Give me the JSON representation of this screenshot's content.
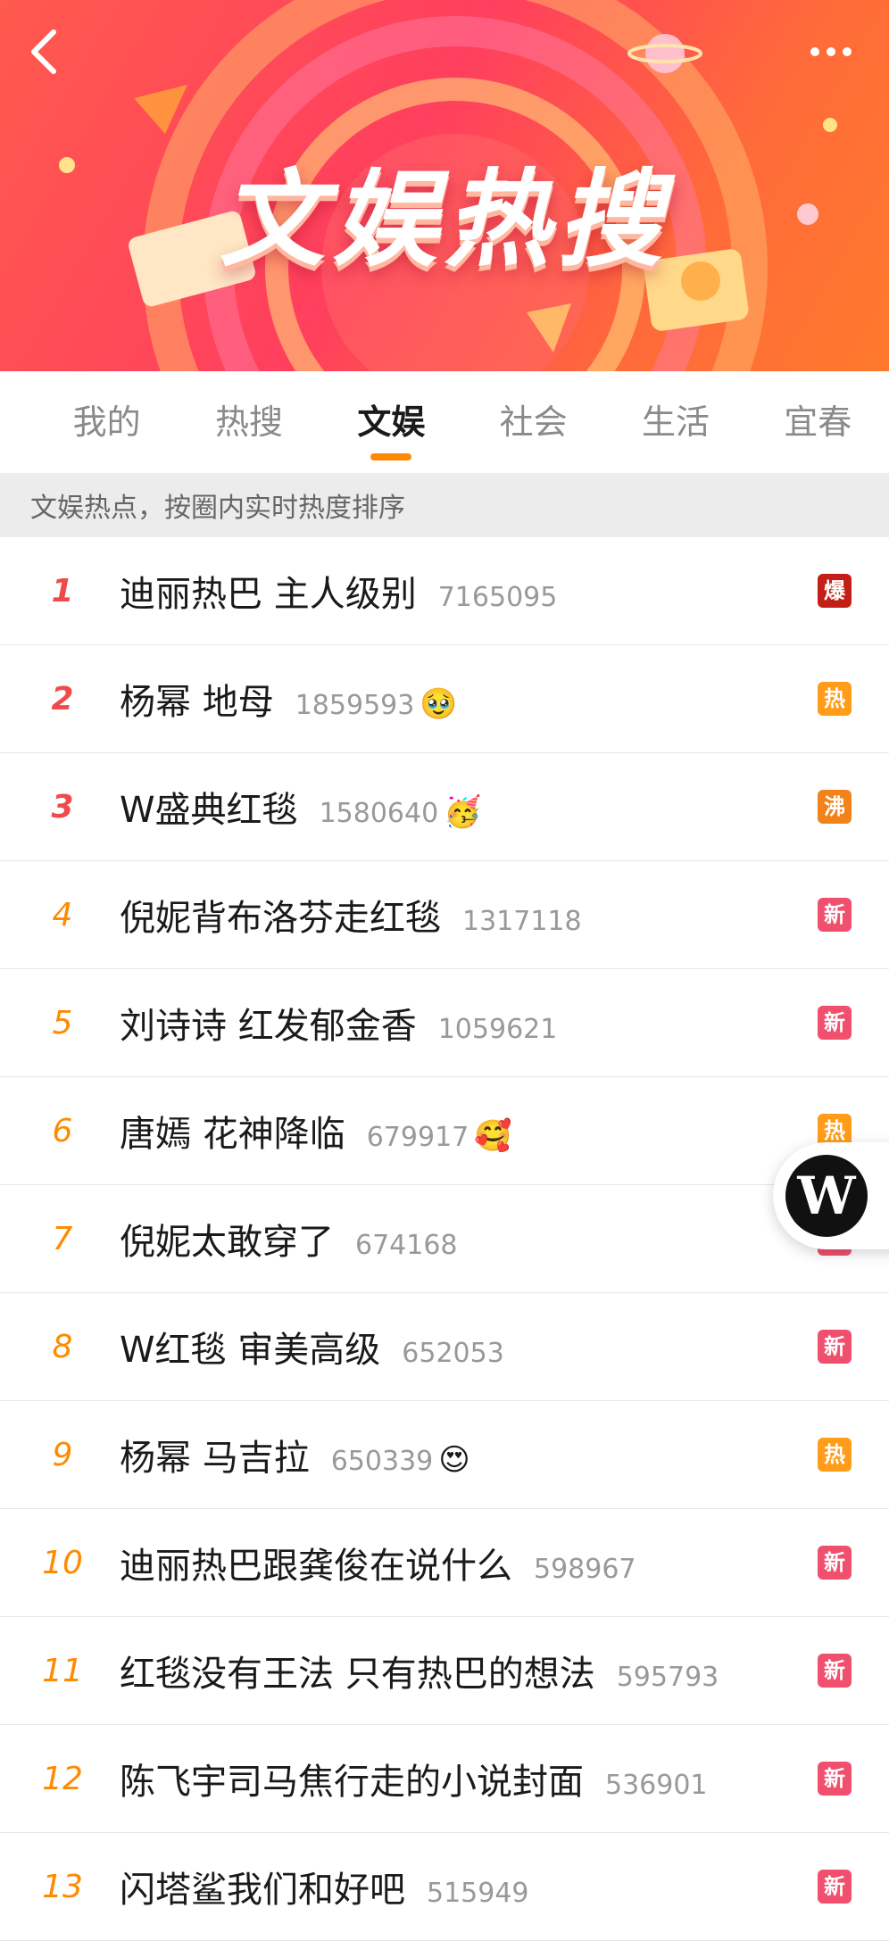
{
  "banner": {
    "title": "文娱热搜",
    "back_icon": "chevron-left-icon",
    "more_icon": "more-dots-icon"
  },
  "tabs": [
    {
      "label": "我的",
      "active": false
    },
    {
      "label": "热搜",
      "active": false
    },
    {
      "label": "文娱",
      "active": true
    },
    {
      "label": "社会",
      "active": false
    },
    {
      "label": "生活",
      "active": false
    },
    {
      "label": "宜春",
      "active": false
    }
  ],
  "subheader": "文娱热点，按圈内实时热度排序",
  "list": [
    {
      "rank": "1",
      "title": "迪丽热巴 主人级别",
      "count": "7165095",
      "emoji": "",
      "badge": "爆",
      "badge_color": "#c41f16"
    },
    {
      "rank": "2",
      "title": "杨幂 地母",
      "count": "1859593",
      "emoji": "🥹",
      "badge": "热",
      "badge_color": "#ff9d1a"
    },
    {
      "rank": "3",
      "title": "W盛典红毯",
      "count": "1580640",
      "emoji": "🥳",
      "badge": "沸",
      "badge_color": "#f2821a"
    },
    {
      "rank": "4",
      "title": "倪妮背布洛芬走红毯",
      "count": "1317118",
      "emoji": "",
      "badge": "新",
      "badge_color": "#f0506e"
    },
    {
      "rank": "5",
      "title": "刘诗诗 红发郁金香",
      "count": "1059621",
      "emoji": "",
      "badge": "新",
      "badge_color": "#f0506e"
    },
    {
      "rank": "6",
      "title": "唐嫣 花神降临",
      "count": "679917",
      "emoji": "🥰",
      "badge": "热",
      "badge_color": "#ff9d1a"
    },
    {
      "rank": "7",
      "title": "倪妮太敢穿了",
      "count": "674168",
      "emoji": "",
      "badge": "新",
      "badge_color": "#f0506e"
    },
    {
      "rank": "8",
      "title": "W红毯 审美高级",
      "count": "652053",
      "emoji": "",
      "badge": "新",
      "badge_color": "#f0506e"
    },
    {
      "rank": "9",
      "title": "杨幂 马吉拉",
      "count": "650339",
      "emoji": "😍",
      "badge": "热",
      "badge_color": "#ff9d1a"
    },
    {
      "rank": "10",
      "title": "迪丽热巴跟龚俊在说什么",
      "count": "598967",
      "emoji": "",
      "badge": "新",
      "badge_color": "#f0506e"
    },
    {
      "rank": "11",
      "title": "红毯没有王法 只有热巴的想法",
      "count": "595793",
      "emoji": "",
      "badge": "新",
      "badge_color": "#f0506e"
    },
    {
      "rank": "12",
      "title": "陈飞宇司马焦行走的小说封面",
      "count": "536901",
      "emoji": "",
      "badge": "新",
      "badge_color": "#f0506e"
    },
    {
      "rank": "13",
      "title": "闪塔鲨我们和好吧",
      "count": "515949",
      "emoji": "",
      "badge": "新",
      "badge_color": "#f0506e"
    }
  ],
  "float_button": {
    "letter": "W"
  }
}
